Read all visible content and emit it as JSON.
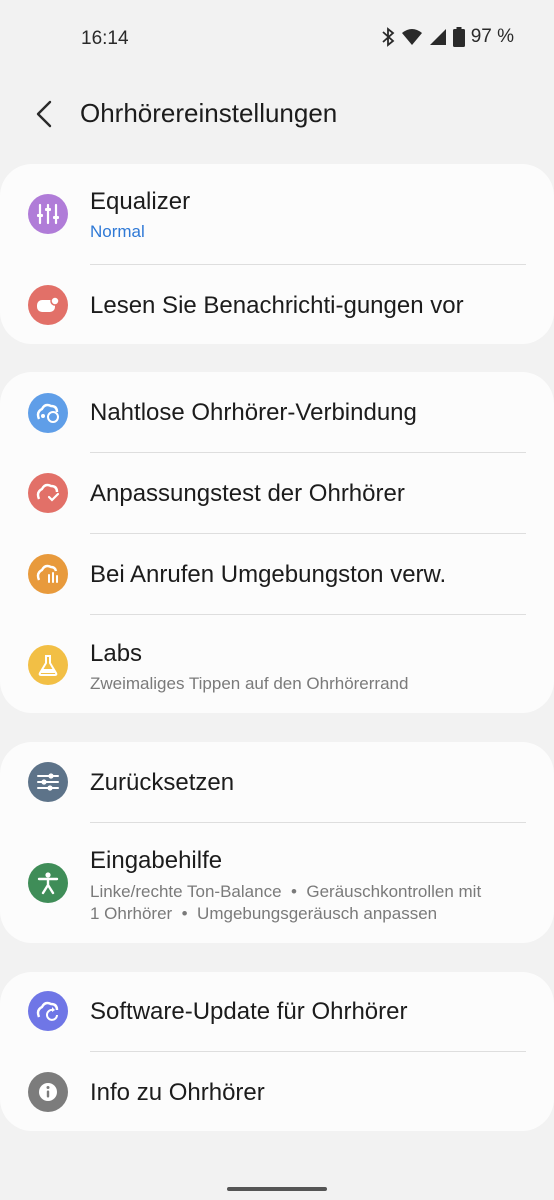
{
  "status": {
    "time": "16:14",
    "battery": "97 %",
    "icons": [
      "bluetooth-icon",
      "wifi-icon",
      "signal-icon",
      "battery-icon"
    ]
  },
  "header": {
    "title": "Ohrhörereinstellungen",
    "back_icon": "back-arrow-icon"
  },
  "colors": {
    "accent": "#2f79d6",
    "card": "#fcfcfc",
    "background": "#f2f2f2"
  },
  "sections": [
    [
      {
        "label": "Equalizer",
        "sub": "Normal",
        "icon": "equalizer-icon",
        "color": "#b07cd8"
      },
      {
        "label": "Lesen Sie Benachrichti-gungen vor",
        "icon": "notification-read-icon",
        "color": "#e27068"
      }
    ],
    [
      {
        "label": "Nahtlose Ohrhörer-Verbindung",
        "icon": "seamless-connection-icon",
        "color": "#5f9ee8"
      },
      {
        "label": "Anpassungstest der Ohrhörer",
        "icon": "fit-test-icon",
        "color": "#e27068"
      },
      {
        "label": "Bei Anrufen Umgebungston verw.",
        "icon": "ambient-sound-icon",
        "color": "#e89a3c"
      },
      {
        "label": "Labs",
        "sub": "Zweimaliges Tippen auf den Ohrhörerrand",
        "icon": "labs-flask-icon",
        "color": "#f2bf45"
      }
    ],
    [
      {
        "label": "Zurücksetzen",
        "icon": "reset-sliders-icon",
        "color": "#5d7389"
      },
      {
        "label": "Eingabehilfe",
        "sub1": "Linke/rechte Ton-Balance  •  Geräuschkontrollen mit",
        "sub2": "1 Ohrhörer  •  Umgebungsgeräusch anpassen",
        "icon": "accessibility-icon",
        "color": "#3f8d58"
      }
    ],
    [
      {
        "label": "Software-Update für Ohrhörer",
        "icon": "software-update-icon",
        "color": "#6f76e6"
      },
      {
        "label": "Info zu Ohrhörer",
        "icon": "info-icon",
        "color": "#7c7c7c"
      }
    ]
  ]
}
